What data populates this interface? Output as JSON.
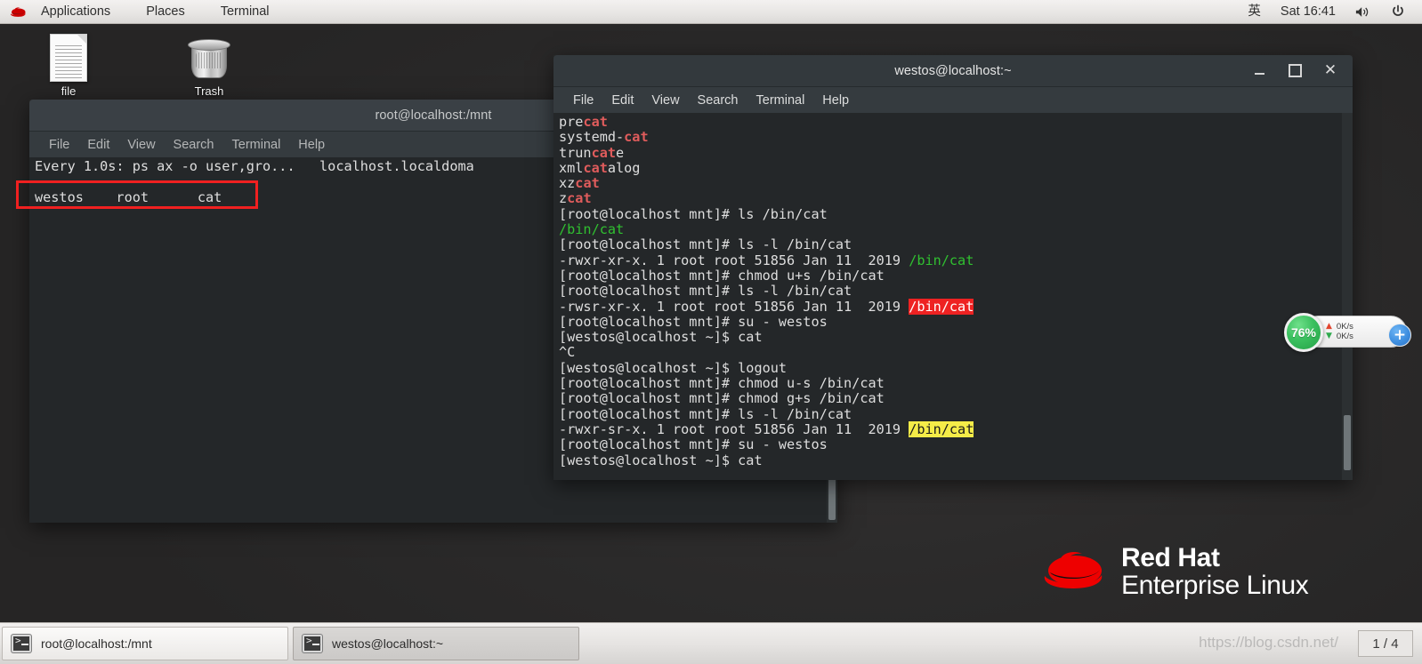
{
  "top_panel": {
    "logo_icon": "redhat-logo-icon",
    "menus": [
      "Applications",
      "Places",
      "Terminal"
    ],
    "ime": "英",
    "clock": "Sat 16:41",
    "volume_icon": "volume-icon",
    "power_icon": "power-icon"
  },
  "desktop": {
    "icons": [
      {
        "name": "file",
        "label": "file",
        "icon": "document-icon"
      },
      {
        "name": "trash",
        "label": "Trash",
        "icon": "trash-icon"
      }
    ],
    "brand": {
      "line1": "Red Hat",
      "line2": "Enterprise Linux",
      "logo_icon": "redhat-hat-icon"
    },
    "watermark": "https://blog.csdn.net/"
  },
  "window_background": {
    "title": "root@localhost:/mnt",
    "menu": [
      "File",
      "Edit",
      "View",
      "Search",
      "Terminal",
      "Help"
    ],
    "lines": [
      {
        "segments": [
          {
            "text": "Every 1.0s: ps ax -o user,gro...   localhost.localdoma",
            "style": ""
          }
        ]
      },
      {
        "segments": []
      },
      {
        "segments": [
          {
            "text": "westos    root      cat",
            "style": ""
          }
        ]
      }
    ]
  },
  "window_foreground": {
    "title": "westos@localhost:~",
    "menu": [
      "File",
      "Edit",
      "View",
      "Search",
      "Terminal",
      "Help"
    ],
    "controls": {
      "minimize": "minimize-button",
      "maximize": "maximize-button",
      "close": "close-button"
    },
    "lines": [
      {
        "segments": [
          {
            "text": "pre",
            "style": ""
          },
          {
            "text": "cat",
            "style": "c-red"
          }
        ]
      },
      {
        "segments": [
          {
            "text": "systemd-",
            "style": ""
          },
          {
            "text": "cat",
            "style": "c-red"
          }
        ]
      },
      {
        "segments": [
          {
            "text": "trun",
            "style": ""
          },
          {
            "text": "cat",
            "style": "c-red"
          },
          {
            "text": "e",
            "style": ""
          }
        ]
      },
      {
        "segments": [
          {
            "text": "xml",
            "style": ""
          },
          {
            "text": "cat",
            "style": "c-red"
          },
          {
            "text": "alog",
            "style": ""
          }
        ]
      },
      {
        "segments": [
          {
            "text": "xz",
            "style": ""
          },
          {
            "text": "cat",
            "style": "c-red"
          }
        ]
      },
      {
        "segments": [
          {
            "text": "z",
            "style": ""
          },
          {
            "text": "cat",
            "style": "c-red"
          }
        ]
      },
      {
        "segments": [
          {
            "text": "[root@localhost mnt]# ls /bin/cat",
            "style": ""
          }
        ]
      },
      {
        "segments": [
          {
            "text": "/bin/cat",
            "style": "c-green"
          }
        ]
      },
      {
        "segments": [
          {
            "text": "[root@localhost mnt]# ls -l /bin/cat",
            "style": ""
          }
        ]
      },
      {
        "segments": [
          {
            "text": "-rwxr-xr-x. 1 root root 51856 Jan 11  2019 ",
            "style": ""
          },
          {
            "text": "/bin/cat",
            "style": "c-green"
          }
        ]
      },
      {
        "segments": [
          {
            "text": "[root@localhost mnt]# chmod u+s /bin/cat",
            "style": ""
          }
        ]
      },
      {
        "segments": [
          {
            "text": "[root@localhost mnt]# ls -l /bin/cat",
            "style": ""
          }
        ]
      },
      {
        "segments": [
          {
            "text": "-rwsr-xr-x. 1 root root 51856 Jan 11  2019 ",
            "style": ""
          },
          {
            "text": "/bin/cat",
            "style": "hl-red"
          }
        ]
      },
      {
        "segments": [
          {
            "text": "[root@localhost mnt]# su - westos",
            "style": ""
          }
        ]
      },
      {
        "segments": [
          {
            "text": "[westos@localhost ~]$ cat",
            "style": ""
          }
        ]
      },
      {
        "segments": [
          {
            "text": "^C",
            "style": ""
          }
        ]
      },
      {
        "segments": [
          {
            "text": "[westos@localhost ~]$ logout",
            "style": ""
          }
        ]
      },
      {
        "segments": [
          {
            "text": "[root@localhost mnt]# chmod u-s /bin/cat",
            "style": ""
          }
        ]
      },
      {
        "segments": [
          {
            "text": "[root@localhost mnt]# chmod g+s /bin/cat",
            "style": ""
          }
        ]
      },
      {
        "segments": [
          {
            "text": "[root@localhost mnt]# ls -l /bin/cat",
            "style": ""
          }
        ]
      },
      {
        "segments": [
          {
            "text": "-rwxr-sr-x. 1 root root 51856 Jan 11  2019 ",
            "style": ""
          },
          {
            "text": "/bin/cat",
            "style": "hl-yellow"
          }
        ]
      },
      {
        "segments": [
          {
            "text": "[root@localhost mnt]# su - westos",
            "style": ""
          }
        ]
      },
      {
        "segments": [
          {
            "text": "[westos@localhost ~]$ cat",
            "style": ""
          }
        ]
      }
    ]
  },
  "speed_widget": {
    "percent": "76%",
    "upload_icon": "arrow-up-icon",
    "download_icon": "arrow-down-icon",
    "upload_rate": "0K/s",
    "download_rate": "0K/s",
    "add_label": "+"
  },
  "taskbar": {
    "items": [
      {
        "label": "root@localhost:/mnt",
        "icon": "terminal-icon",
        "active": false
      },
      {
        "label": "westos@localhost:~",
        "icon": "terminal-icon",
        "active": true
      }
    ],
    "workspace": "1 / 4"
  },
  "colors": {
    "accent_red": "#ee2222",
    "accent_green": "#30c030",
    "accent_yellow": "#f5ec48",
    "annotation_red": "#f02020",
    "terminal_bg": "#242729"
  }
}
